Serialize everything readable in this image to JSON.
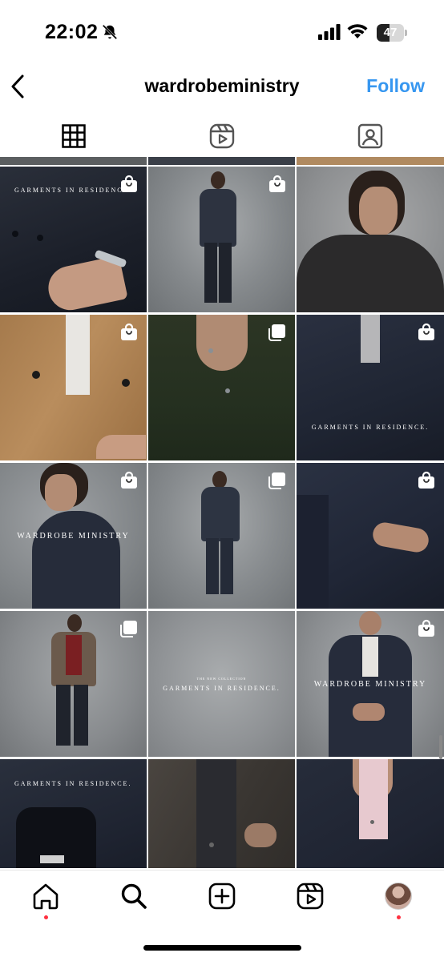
{
  "status_bar": {
    "time": "22:02",
    "battery": "47",
    "battery_level": 0.47
  },
  "header": {
    "title": "wardrobeministry",
    "follow_label": "Follow"
  },
  "tabs": [
    {
      "name": "posts",
      "icon": "grid-icon",
      "active": true
    },
    {
      "name": "reels",
      "icon": "reels-icon",
      "active": false
    },
    {
      "name": "tagged",
      "icon": "tagged-icon",
      "active": false
    }
  ],
  "grid": {
    "tiles": [
      {
        "caption": "GARMENTS IN RESIDENCE.",
        "badge": "shopping-bag-icon"
      },
      {
        "caption": "",
        "badge": "shopping-bag-icon"
      },
      {
        "caption": "",
        "badge": ""
      },
      {
        "caption": "",
        "badge": "shopping-bag-icon"
      },
      {
        "caption": "",
        "badge": "carousel-icon"
      },
      {
        "caption": "GARMENTS IN RESIDENCE.",
        "badge": "shopping-bag-icon"
      },
      {
        "caption": "WARDROBE MINISTRY",
        "badge": "shopping-bag-icon"
      },
      {
        "caption": "",
        "badge": "carousel-icon"
      },
      {
        "caption": "",
        "badge": "shopping-bag-icon"
      },
      {
        "caption": "",
        "badge": "carousel-icon"
      },
      {
        "caption_small": "THE NEW COLLECTION",
        "caption": "GARMENTS IN RESIDENCE.",
        "badge": ""
      },
      {
        "caption": "WARDROBE MINISTRY",
        "badge": "shopping-bag-icon"
      },
      {
        "caption": "GARMENTS IN RESIDENCE.",
        "badge": ""
      },
      {
        "caption": "",
        "badge": ""
      },
      {
        "caption": "",
        "badge": ""
      }
    ]
  },
  "bottom_nav": [
    {
      "name": "home",
      "icon": "home-icon",
      "dot": true
    },
    {
      "name": "search",
      "icon": "search-icon",
      "dot": false
    },
    {
      "name": "create",
      "icon": "plus-square-icon",
      "dot": false
    },
    {
      "name": "reels",
      "icon": "reels-icon",
      "dot": false
    },
    {
      "name": "profile",
      "icon": "avatar",
      "dot": true
    }
  ],
  "colors": {
    "accent": "#3797f0",
    "notification": "#ff3040"
  }
}
